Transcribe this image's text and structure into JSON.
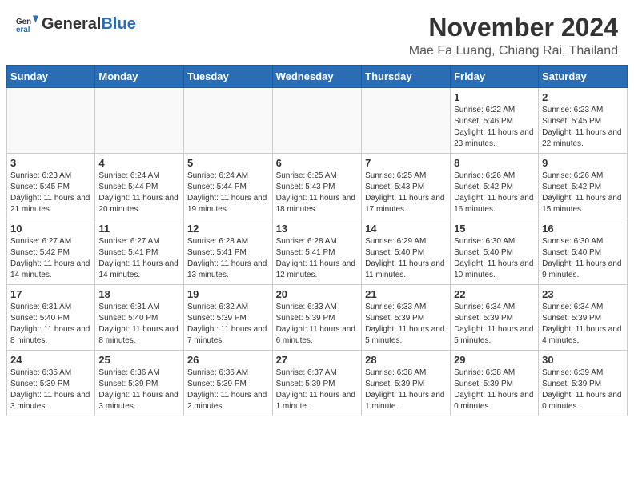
{
  "header": {
    "logo_general": "General",
    "logo_blue": "Blue",
    "month_year": "November 2024",
    "location": "Mae Fa Luang, Chiang Rai, Thailand"
  },
  "weekdays": [
    "Sunday",
    "Monday",
    "Tuesday",
    "Wednesday",
    "Thursday",
    "Friday",
    "Saturday"
  ],
  "weeks": [
    [
      {
        "day": "",
        "info": ""
      },
      {
        "day": "",
        "info": ""
      },
      {
        "day": "",
        "info": ""
      },
      {
        "day": "",
        "info": ""
      },
      {
        "day": "",
        "info": ""
      },
      {
        "day": "1",
        "info": "Sunrise: 6:22 AM\nSunset: 5:46 PM\nDaylight: 11 hours and 23 minutes."
      },
      {
        "day": "2",
        "info": "Sunrise: 6:23 AM\nSunset: 5:45 PM\nDaylight: 11 hours and 22 minutes."
      }
    ],
    [
      {
        "day": "3",
        "info": "Sunrise: 6:23 AM\nSunset: 5:45 PM\nDaylight: 11 hours and 21 minutes."
      },
      {
        "day": "4",
        "info": "Sunrise: 6:24 AM\nSunset: 5:44 PM\nDaylight: 11 hours and 20 minutes."
      },
      {
        "day": "5",
        "info": "Sunrise: 6:24 AM\nSunset: 5:44 PM\nDaylight: 11 hours and 19 minutes."
      },
      {
        "day": "6",
        "info": "Sunrise: 6:25 AM\nSunset: 5:43 PM\nDaylight: 11 hours and 18 minutes."
      },
      {
        "day": "7",
        "info": "Sunrise: 6:25 AM\nSunset: 5:43 PM\nDaylight: 11 hours and 17 minutes."
      },
      {
        "day": "8",
        "info": "Sunrise: 6:26 AM\nSunset: 5:42 PM\nDaylight: 11 hours and 16 minutes."
      },
      {
        "day": "9",
        "info": "Sunrise: 6:26 AM\nSunset: 5:42 PM\nDaylight: 11 hours and 15 minutes."
      }
    ],
    [
      {
        "day": "10",
        "info": "Sunrise: 6:27 AM\nSunset: 5:42 PM\nDaylight: 11 hours and 14 minutes."
      },
      {
        "day": "11",
        "info": "Sunrise: 6:27 AM\nSunset: 5:41 PM\nDaylight: 11 hours and 14 minutes."
      },
      {
        "day": "12",
        "info": "Sunrise: 6:28 AM\nSunset: 5:41 PM\nDaylight: 11 hours and 13 minutes."
      },
      {
        "day": "13",
        "info": "Sunrise: 6:28 AM\nSunset: 5:41 PM\nDaylight: 11 hours and 12 minutes."
      },
      {
        "day": "14",
        "info": "Sunrise: 6:29 AM\nSunset: 5:40 PM\nDaylight: 11 hours and 11 minutes."
      },
      {
        "day": "15",
        "info": "Sunrise: 6:30 AM\nSunset: 5:40 PM\nDaylight: 11 hours and 10 minutes."
      },
      {
        "day": "16",
        "info": "Sunrise: 6:30 AM\nSunset: 5:40 PM\nDaylight: 11 hours and 9 minutes."
      }
    ],
    [
      {
        "day": "17",
        "info": "Sunrise: 6:31 AM\nSunset: 5:40 PM\nDaylight: 11 hours and 8 minutes."
      },
      {
        "day": "18",
        "info": "Sunrise: 6:31 AM\nSunset: 5:40 PM\nDaylight: 11 hours and 8 minutes."
      },
      {
        "day": "19",
        "info": "Sunrise: 6:32 AM\nSunset: 5:39 PM\nDaylight: 11 hours and 7 minutes."
      },
      {
        "day": "20",
        "info": "Sunrise: 6:33 AM\nSunset: 5:39 PM\nDaylight: 11 hours and 6 minutes."
      },
      {
        "day": "21",
        "info": "Sunrise: 6:33 AM\nSunset: 5:39 PM\nDaylight: 11 hours and 5 minutes."
      },
      {
        "day": "22",
        "info": "Sunrise: 6:34 AM\nSunset: 5:39 PM\nDaylight: 11 hours and 5 minutes."
      },
      {
        "day": "23",
        "info": "Sunrise: 6:34 AM\nSunset: 5:39 PM\nDaylight: 11 hours and 4 minutes."
      }
    ],
    [
      {
        "day": "24",
        "info": "Sunrise: 6:35 AM\nSunset: 5:39 PM\nDaylight: 11 hours and 3 minutes."
      },
      {
        "day": "25",
        "info": "Sunrise: 6:36 AM\nSunset: 5:39 PM\nDaylight: 11 hours and 3 minutes."
      },
      {
        "day": "26",
        "info": "Sunrise: 6:36 AM\nSunset: 5:39 PM\nDaylight: 11 hours and 2 minutes."
      },
      {
        "day": "27",
        "info": "Sunrise: 6:37 AM\nSunset: 5:39 PM\nDaylight: 11 hours and 1 minute."
      },
      {
        "day": "28",
        "info": "Sunrise: 6:38 AM\nSunset: 5:39 PM\nDaylight: 11 hours and 1 minute."
      },
      {
        "day": "29",
        "info": "Sunrise: 6:38 AM\nSunset: 5:39 PM\nDaylight: 11 hours and 0 minutes."
      },
      {
        "day": "30",
        "info": "Sunrise: 6:39 AM\nSunset: 5:39 PM\nDaylight: 11 hours and 0 minutes."
      }
    ]
  ]
}
